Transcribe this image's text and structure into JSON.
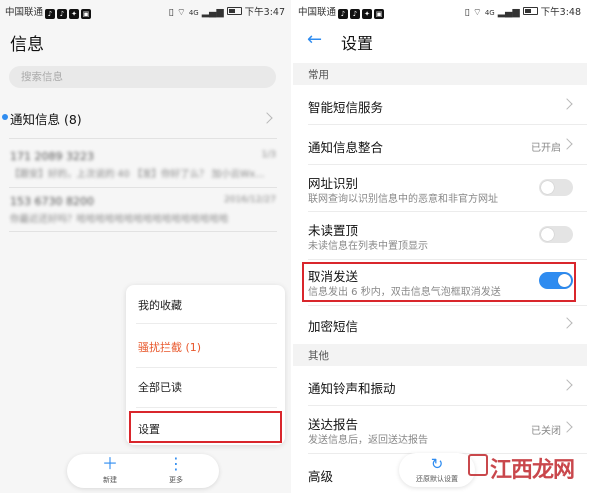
{
  "left": {
    "status": {
      "carrier": "中国联通",
      "signal": "4G",
      "time": "下午3:47"
    },
    "title": "信息",
    "search_placeholder": "搜索信息",
    "notify_label": "通知信息 (8)",
    "blurred_rows": [
      {
        "a": "171 2089 3223",
        "b": "1/3",
        "c": "【跟安】好的，上次说的 40 【发】你好了么？ 加小云Wx…"
      },
      {
        "a": "153 6730 8200",
        "b": "2016/12/27",
        "c": "你最近还好吗？哈哈哈哈哈哈哈哈哈哈哈哈哈哈哈哈"
      }
    ],
    "menu": [
      {
        "label": "我的收藏"
      },
      {
        "label": "骚扰拦截 (1)"
      },
      {
        "label": "全部已读"
      },
      {
        "label": "设置"
      }
    ],
    "bottombar": [
      {
        "icon": "plus-icon",
        "label": "新建"
      },
      {
        "icon": "more-icon",
        "label": "更多"
      }
    ]
  },
  "right": {
    "status": {
      "carrier": "中国联通",
      "signal": "4G",
      "time": "下午3:48"
    },
    "back_icon": "arrow-left-icon",
    "title": "设置",
    "section_common": "常用",
    "rows": {
      "smart": {
        "title": "智能短信服务"
      },
      "merge": {
        "title": "通知信息整合",
        "value": "已开启"
      },
      "url": {
        "title": "网址识别",
        "sub": "联网查询以识别信息中的恶意和非官方网址",
        "toggle": false
      },
      "unread": {
        "title": "未读置顶",
        "sub": "未读信息在列表中置顶显示",
        "toggle": false
      },
      "cancel": {
        "title": "取消发送",
        "sub": "信息发出 6 秒内，双击信息气泡框取消发送",
        "toggle": true
      },
      "encrypt": {
        "title": "加密短信"
      },
      "ringtone": {
        "title": "通知铃声和振动"
      },
      "report": {
        "title": "送达报告",
        "sub": "发送信息后，返回送达报告",
        "value": "已关闭"
      },
      "advanced": {
        "title": "高级"
      }
    },
    "section_other": "其他",
    "restore_label": "还原默认设置",
    "watermark": "江西龙网"
  },
  "colors": {
    "accent": "#2f8cf0",
    "highlight": "#d9262c",
    "warn": "#e8572b"
  }
}
